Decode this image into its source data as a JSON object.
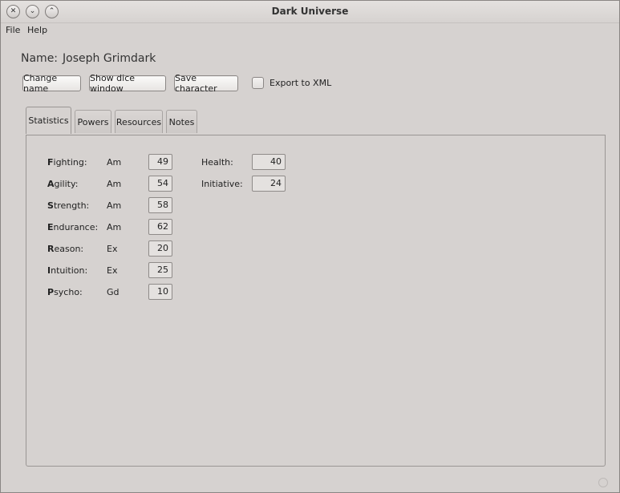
{
  "window": {
    "title": "Dark Universe"
  },
  "menu": [
    "File",
    "Help"
  ],
  "character": {
    "name_label": "Name:",
    "name": "Joseph Grimdark"
  },
  "toolbar": {
    "change_name": "Change name",
    "show_dice": "Show dice window",
    "save_character": "Save character",
    "export_xml": "Export to XML",
    "export_xml_checked": false
  },
  "tabs": [
    {
      "label": "Statistics",
      "active": true
    },
    {
      "label": "Powers",
      "active": false
    },
    {
      "label": "Resources",
      "active": false
    },
    {
      "label": "Notes",
      "active": false
    }
  ],
  "stats": [
    {
      "first": "F",
      "rest": "ighting:",
      "rank": "Am",
      "value": "49"
    },
    {
      "first": "A",
      "rest": "gility:",
      "rank": "Am",
      "value": "54"
    },
    {
      "first": "S",
      "rest": "trength:",
      "rank": "Am",
      "value": "58"
    },
    {
      "first": "E",
      "rest": "ndurance:",
      "rank": "Am",
      "value": "62"
    },
    {
      "first": "R",
      "rest": "eason:",
      "rank": "Ex",
      "value": "20"
    },
    {
      "first": "I",
      "rest": "ntuition:",
      "rank": "Ex",
      "value": "25"
    },
    {
      "first": "P",
      "rest": "sycho:",
      "rank": "Gd",
      "value": "10"
    }
  ],
  "derived": [
    {
      "label": "Health:",
      "value": "40"
    },
    {
      "label": "Initiative:",
      "value": "24"
    }
  ]
}
